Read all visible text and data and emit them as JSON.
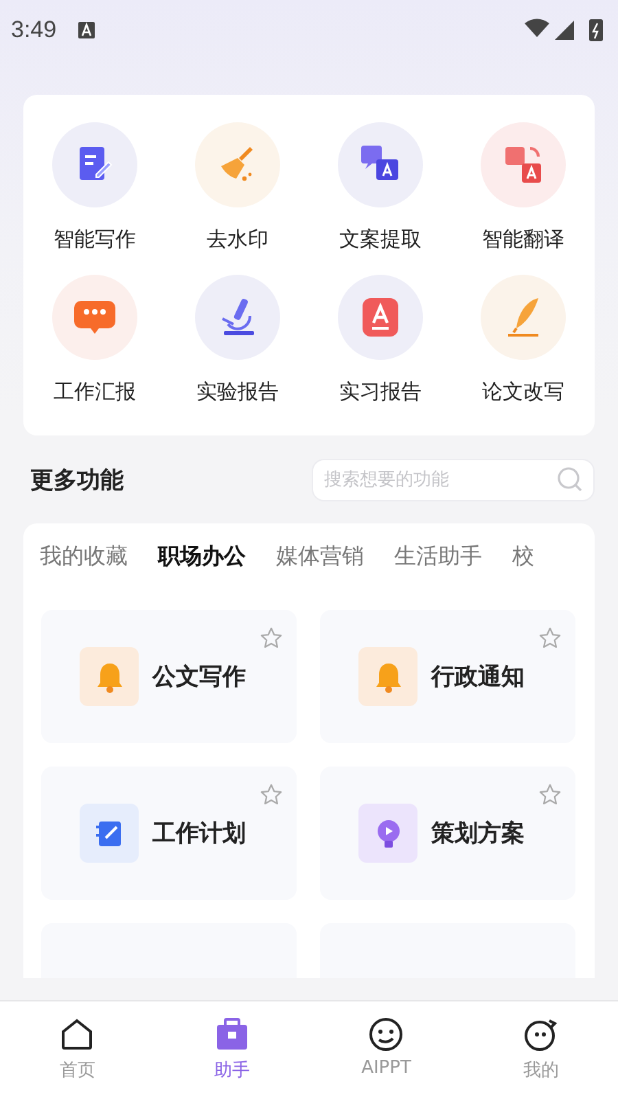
{
  "status_bar": {
    "time": "3:49"
  },
  "tools": [
    {
      "label": "智能写作"
    },
    {
      "label": "去水印"
    },
    {
      "label": "文案提取"
    },
    {
      "label": "智能翻译"
    },
    {
      "label": "工作汇报"
    },
    {
      "label": "实验报告"
    },
    {
      "label": "实习报告"
    },
    {
      "label": "论文改写"
    }
  ],
  "more": {
    "title": "更多功能",
    "search": {
      "placeholder": "搜索想要的功能"
    }
  },
  "tabs": [
    {
      "label": "我的收藏",
      "selected": false
    },
    {
      "label": "职场办公",
      "selected": true
    },
    {
      "label": "媒体营销",
      "selected": false
    },
    {
      "label": "生活助手",
      "selected": false
    },
    {
      "label": "校",
      "selected": false
    }
  ],
  "features": [
    {
      "title": "公文写作",
      "starred": false
    },
    {
      "title": "行政通知",
      "starred": false
    },
    {
      "title": "工作计划",
      "starred": false
    },
    {
      "title": "策划方案",
      "starred": false
    }
  ],
  "bottom_nav": [
    {
      "label": "首页",
      "selected": false
    },
    {
      "label": "助手",
      "selected": true
    },
    {
      "label": "AIPPT",
      "selected": false
    },
    {
      "label": "我的",
      "selected": false
    }
  ]
}
